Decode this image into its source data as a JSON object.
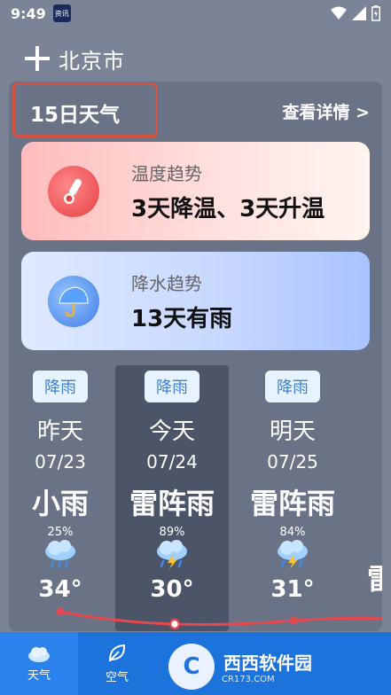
{
  "status": {
    "time": "9:49",
    "app_icon_text": "资讯"
  },
  "header": {
    "city": "北京市"
  },
  "panel": {
    "title": "15日天气",
    "detail": "查看详情 >",
    "temp_trend": {
      "label": "温度趋势",
      "value": "3天降温、3天升温"
    },
    "rain_trend": {
      "label": "降水趋势",
      "value": "13天有雨"
    }
  },
  "days": [
    {
      "badge": "降雨",
      "name": "昨天",
      "date": "07/23",
      "weather": "小雨",
      "pop": "25%",
      "temp": "34°"
    },
    {
      "badge": "降雨",
      "name": "今天",
      "date": "07/24",
      "weather": "雷阵雨",
      "pop": "89%",
      "temp": "30°"
    },
    {
      "badge": "降雨",
      "name": "明天",
      "date": "07/25",
      "weather": "雷阵雨",
      "pop": "84%",
      "temp": "31°"
    }
  ],
  "partial_day": {
    "weather": "雷"
  },
  "nav": [
    {
      "label": "天气"
    },
    {
      "label": "空气"
    }
  ],
  "watermark": {
    "brand": "西西软件园",
    "sub": "CR173.COM",
    "logo": "C"
  },
  "colors": {
    "accent": "#1c73dc",
    "highlight_border": "#d4523f",
    "temp_line": "#e5484d"
  }
}
